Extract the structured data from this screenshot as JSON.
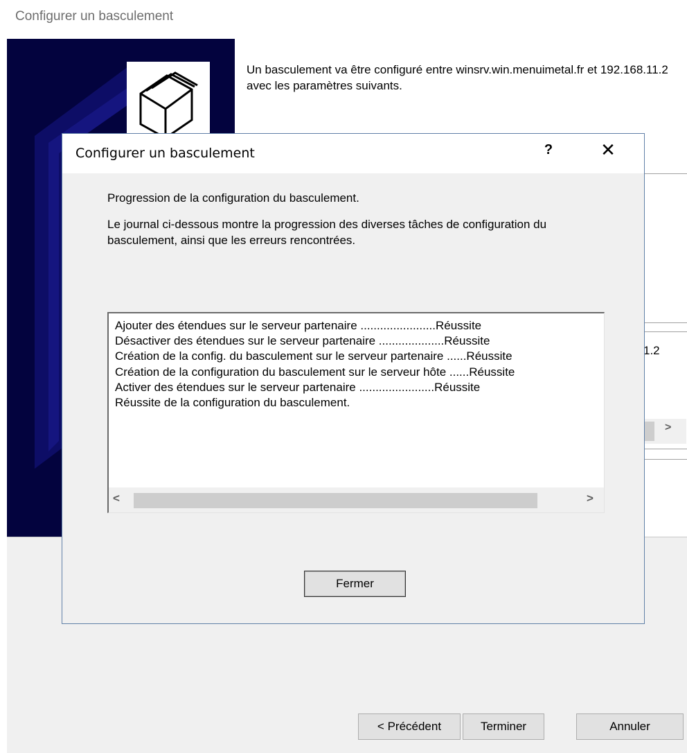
{
  "wizard": {
    "title": "Configurer un basculement",
    "intro": "Un basculement va être configuré entre winsrv.win.menuimetal.fr et 192.168.11.2 avec les paramètres suivants.",
    "partial_value": "1.2",
    "buttons": {
      "previous": "< Précédent",
      "finish": "Terminer",
      "cancel": "Annuler"
    },
    "colors": {
      "banner": "#03033e",
      "banner_stripes": "#14147a"
    },
    "icon": "folders-icon"
  },
  "dialog": {
    "title": "Configurer un basculement",
    "help": "?",
    "close": "✕",
    "heading": "Progression de la configuration du basculement.",
    "description": "Le journal ci-dessous montre la progression des diverses tâches de configuration du basculement, ainsi que les erreurs rencontrées.",
    "log": [
      "Ajouter des étendues sur le serveur partenaire .......................Réussite",
      "Désactiver des étendues sur le serveur partenaire ....................Réussite",
      "Création de la config. du basculement sur le serveur partenaire ......Réussite",
      "Création de la configuration du basculement sur le serveur hôte ......Réussite",
      "Activer des étendues sur le serveur partenaire .......................Réussite",
      "Réussite de la configuration du basculement."
    ],
    "close_button": "Fermer"
  }
}
